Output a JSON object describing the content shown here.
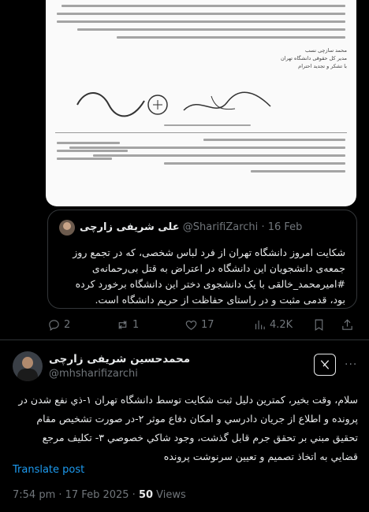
{
  "quoted": {
    "author_name": "علی شریفی زارچی",
    "author_handle": "@SharifiZarchi",
    "date": "16 Feb",
    "text": "شکایت امروز دانشگاه تهران از فرد لباس شخصی، که در تجمع روز جمعه‌ی دانشجویان این دانشگاه در اعتراض به قتل بی‌رحمانه‌ی #امیرمحمد_خالقی با یک دانشجوی دختر این دانشگاه برخورد کرده بود، قدمی مثبت و در راستای حفاظت از حریم دانشگاه است.",
    "document_texts": [
      "محمد سازچی نسب",
      "مدیر کل حقوقی دانشگاه تهران",
      "با تشکر و تجدید احترام"
    ]
  },
  "actions": {
    "replies": "2",
    "reposts": "1",
    "likes": "17",
    "views": "4.2K"
  },
  "post": {
    "author_name": "محمدحسین شریفی زارچی",
    "author_handle": "@mhsharifizarchi",
    "text": "سلام، وقت بخير، كمترين دليل ثبت شكايت توسط دانشگاه تهران ۱-ذي نفع شدن در پرونده و اطلاع از جريان دادرسي و امكان دفاع موثر ۲-در صورت تشخيص مقام تحقيق مبني بر تحقق جرم قابل گذشت، وجود شاكي خصوصي ۳- تكليف مرجع قضايي به اتخاذ تصميم و تعيين سرنوشت پرونده",
    "translate_label": "Translate post",
    "time": "7:54 pm · 17 Feb 2025 · ",
    "views_count": "50",
    "views_label": " Views",
    "more_label": "···"
  },
  "icons": {
    "reply": "reply-icon",
    "repost": "repost-icon",
    "like": "heart-icon",
    "views": "analytics-icon",
    "bookmark": "bookmark-icon",
    "share": "share-icon",
    "grok": "grok-icon"
  },
  "colors": {
    "background": "#000000",
    "text": "#e7e9ea",
    "muted": "#71767b",
    "accent": "#1d9bf0",
    "border": "#2f3336"
  }
}
